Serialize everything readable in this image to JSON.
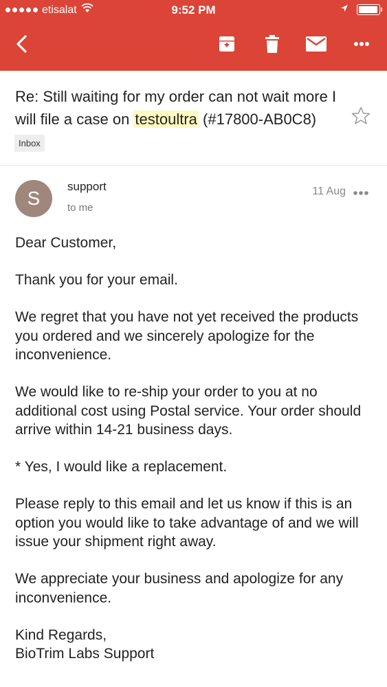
{
  "status": {
    "carrier": "etisalat",
    "time": "9:52 PM"
  },
  "toolbar": {
    "back_icon": "chevron-left-icon",
    "archive_icon": "archive-icon",
    "delete_icon": "trash-icon",
    "mark_unread_icon": "mail-icon",
    "more_icon": "more-horizontal-icon"
  },
  "colors": {
    "appbar": "#db4437",
    "highlight": "#fdf9c0",
    "avatar": "#a0877b"
  },
  "email": {
    "subject_before": "Re: Still waiting for my order can not wait more I will file a case on ",
    "subject_highlight": "testoultra",
    "subject_after": " (#17800-AB0C8)",
    "label": "Inbox",
    "sender": {
      "initial": "S",
      "name": "support",
      "recipient": "to me",
      "date": "11 Aug"
    },
    "body": [
      "Dear Customer,",
      "Thank you for your email.",
      "We regret that you have not yet received the products you ordered and we sincerely apologize for the inconvenience.",
      "We would like to re-ship your order to you at no additional cost using Postal service. Your order should arrive within 14-21 business days.",
      "* Yes, I would like a replacement.",
      "Please reply to this email and let us know if this is an option you would like to take advantage of and we will issue your shipment right away.",
      "We appreciate your business and apologize for any inconvenience.",
      "Kind Regards,",
      "BioTrim Labs Support"
    ]
  }
}
